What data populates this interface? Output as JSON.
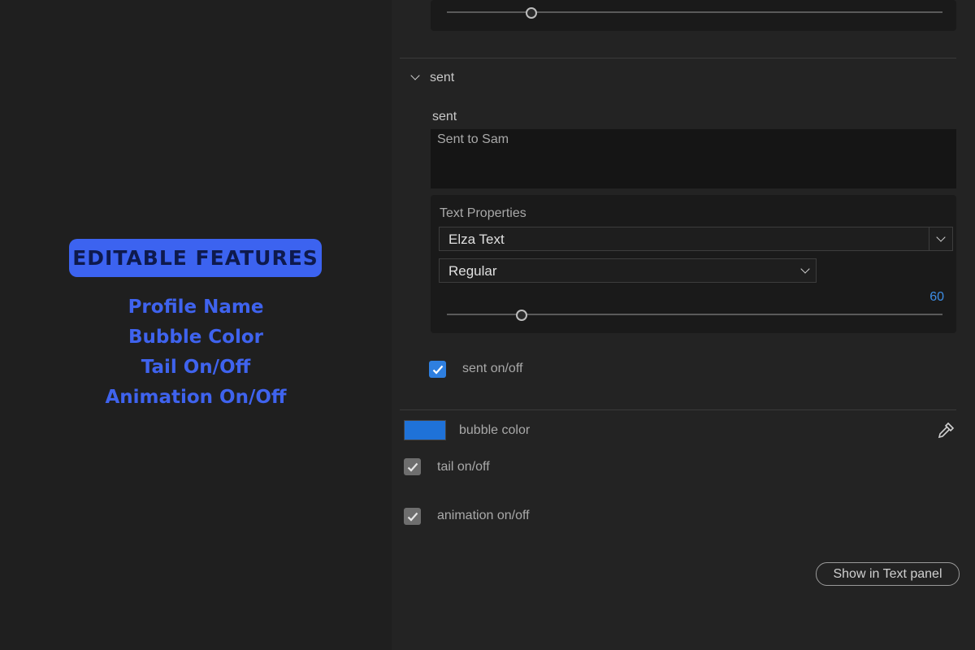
{
  "promo": {
    "badge": "EDITABLE FEATURES",
    "features": [
      "Profile Name",
      "Bubble Color",
      "Tail On/Off",
      "Animation On/Off"
    ]
  },
  "panel": {
    "section_title": "sent",
    "field_label": "sent",
    "text_value": "Sent to Sam",
    "text_properties": {
      "label": "Text Properties",
      "font_family": "Elza Text",
      "font_style": "Regular",
      "font_size": "60",
      "font_size_fraction": 0.15
    },
    "top_slider_fraction": 0.17,
    "sent_toggle": {
      "label": "sent on/off",
      "checked": true
    },
    "bubble_color": {
      "label": "bubble color",
      "swatch": "#1f72d8"
    },
    "tail_toggle": {
      "label": "tail on/off",
      "checked": true
    },
    "animation_toggle": {
      "label": "animation on/off",
      "checked": true
    },
    "show_button": "Show in Text panel"
  },
  "colors": {
    "accent_blue": "#3c63f0",
    "value_blue": "#3d8ee6"
  },
  "icons": [
    "chevron-down-icon",
    "checkmark-icon",
    "eyedropper-icon"
  ]
}
